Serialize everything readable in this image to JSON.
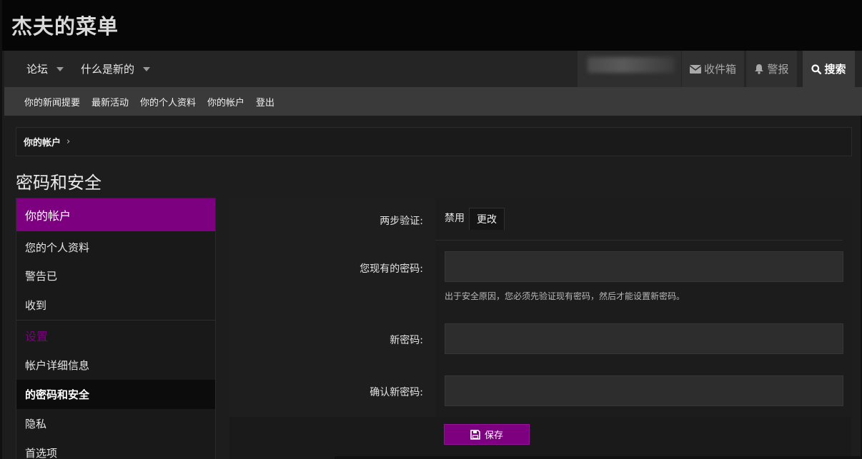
{
  "site": {
    "title": "杰夫的菜单"
  },
  "nav": {
    "items": [
      {
        "label": "论坛"
      },
      {
        "label": "什么是新的"
      }
    ],
    "inbox_label": "收件箱",
    "alerts_label": "警报",
    "search_label": "搜索"
  },
  "subnav": {
    "items": [
      {
        "label": "你的新闻提要"
      },
      {
        "label": "最新活动"
      },
      {
        "label": "你的个人资料"
      },
      {
        "label": "你的帐户"
      },
      {
        "label": "登出"
      }
    ]
  },
  "breadcrumb": {
    "label": "你的帐户",
    "sep": "›"
  },
  "page": {
    "title": "密码和安全"
  },
  "sidebar": {
    "header": "你的帐户",
    "items": [
      {
        "label": "您的个人资料"
      },
      {
        "label": "警告已"
      },
      {
        "label": "收到"
      }
    ],
    "section": "设置",
    "settings_items": [
      {
        "label": "帐户详细信息"
      },
      {
        "label": "的密码和安全"
      },
      {
        "label": "隐私"
      },
      {
        "label": "首选项"
      }
    ]
  },
  "form": {
    "tfa_label": "两步验证:",
    "tfa_status": "禁用",
    "tfa_change": "更改",
    "current_label": "您现有的密码:",
    "current_value": "",
    "hint": "出于安全原因，您必须先验证现有密码，然后才能设置新密码。",
    "new_label": "新密码:",
    "new_value": "",
    "confirm_label": "确认新密码:",
    "confirm_value": "",
    "save_label": "保存"
  },
  "colors": {
    "accent": "#7d0080",
    "header_bg": "#060606",
    "nav_bg": "#252525",
    "subnav_bg": "#3a3a3a"
  },
  "icons": [
    "caret-down-icon",
    "envelope-icon",
    "bell-icon",
    "search-icon",
    "save-icon"
  ]
}
